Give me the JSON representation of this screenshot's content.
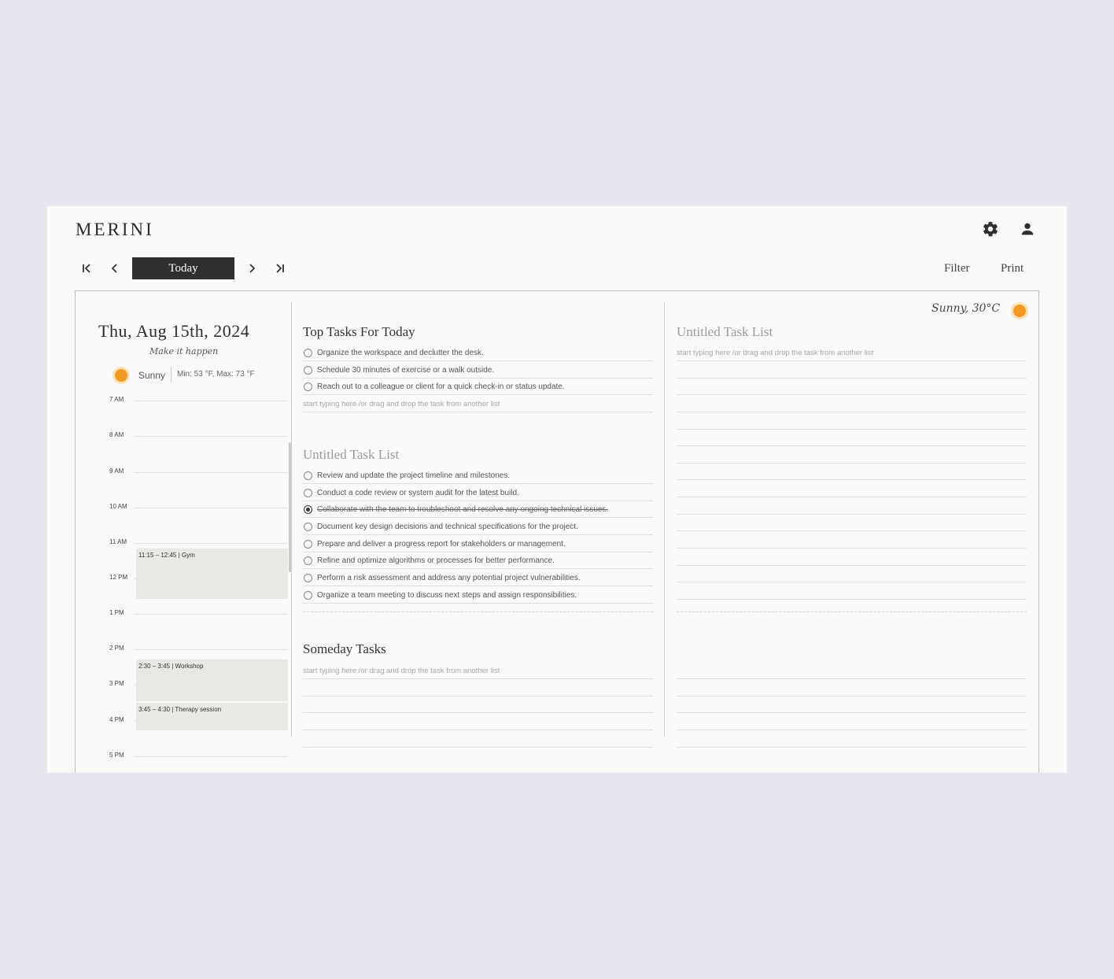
{
  "app": {
    "logo": "MERINI"
  },
  "header": {
    "settings_icon": "gear-icon",
    "profile_icon": "user-icon"
  },
  "nav": {
    "today_label": "Today",
    "first_icon": "skip-first-icon",
    "prev_icon": "chevron-left-icon",
    "next_icon": "chevron-right-icon",
    "last_icon": "skip-last-icon",
    "filter_label": "Filter",
    "print_label": "Print"
  },
  "day": {
    "date": "Thu, Aug 15th, 2024",
    "motto": "Make it happen",
    "weather": {
      "condition": "Sunny",
      "minmax": "Min: 53 °F,  Max: 73 °F",
      "icon": "sun-icon"
    },
    "hours": [
      "7 AM",
      "8 AM",
      "9 AM",
      "10 AM",
      "11 AM",
      "12 PM",
      "1 PM",
      "2 PM",
      "3 PM",
      "4 PM",
      "5 PM"
    ],
    "events": [
      {
        "label": "11:15 – 12:45 | Gym"
      },
      {
        "label": "2:30 – 3:45 | Workshop"
      },
      {
        "label": "3:45 – 4:30 | Therapy session"
      }
    ]
  },
  "top_tasks": {
    "title": "Top Tasks For Today",
    "items": [
      {
        "text": "Organize the workspace and declutter the desk.",
        "done": false
      },
      {
        "text": "Schedule 30 minutes of exercise or a walk outside.",
        "done": false
      },
      {
        "text": "Reach out to a colleague or client for a quick check-in or status update.",
        "done": false
      }
    ],
    "placeholder": "start typing here /or drag and drop the task from another list"
  },
  "untitled_list": {
    "title": "Untitled Task List",
    "items": [
      {
        "text": "Review and update the project timeline and milestones.",
        "done": false
      },
      {
        "text": "Conduct a code review or system audit for the latest build.",
        "done": false
      },
      {
        "text": "Collaborate with the team to troubleshoot and resolve any ongoing technical issues.",
        "done": true
      },
      {
        "text": "Document key design decisions and technical specifications for the project.",
        "done": false
      },
      {
        "text": "Prepare and deliver a progress report for stakeholders or management.",
        "done": false
      },
      {
        "text": "Refine and optimize algorithms or processes for better performance.",
        "done": false
      },
      {
        "text": "Perform a risk assessment and address any potential project vulnerabilities.",
        "done": false
      },
      {
        "text": "Organize a team meeting to discuss next steps and assign responsibilities.",
        "done": false
      }
    ]
  },
  "someday": {
    "title": "Someday Tasks",
    "placeholder": "start typing here /or drag and drop the task from another list"
  },
  "right_list": {
    "title": "Untitled Task List",
    "placeholder": "start typing here /or drag and drop the task from another list"
  },
  "right_weather": {
    "text": "Sunny, 30°C",
    "icon": "sun-icon"
  },
  "colors": {
    "accent_dark": "#2f2f2f",
    "sun": "#f39a26",
    "event_bg": "#e9e9e4",
    "page_bg": "#e6e6ef"
  }
}
